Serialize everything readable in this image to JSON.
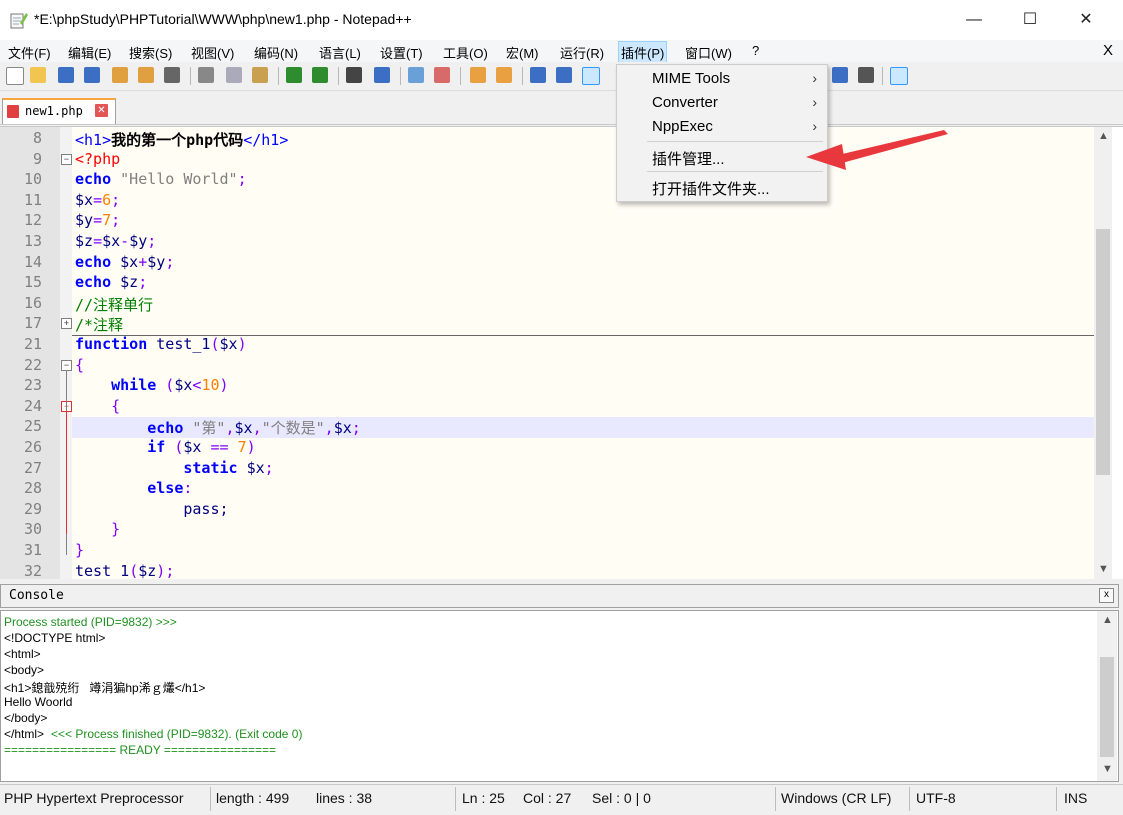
{
  "window": {
    "title": "*E:\\phpStudy\\PHPTutorial\\WWW\\php\\new1.php - Notepad++",
    "minimize": "—",
    "maximize": "☐",
    "close": "✕"
  },
  "menubar": {
    "items": [
      "文件(F)",
      "编辑(E)",
      "搜索(S)",
      "视图(V)",
      "编码(N)",
      "语言(L)",
      "设置(T)",
      "工具(O)",
      "宏(M)",
      "运行(R)",
      "插件(P)",
      "窗口(W)",
      "?"
    ],
    "close": "X"
  },
  "tab": {
    "name": "new1.php",
    "close": "✕"
  },
  "plugins_menu": {
    "items": [
      {
        "label": "MIME Tools",
        "arrow": "›"
      },
      {
        "label": "Converter",
        "arrow": "›"
      },
      {
        "label": "NppExec",
        "arrow": "›"
      },
      {
        "label": "插件管理..."
      },
      {
        "label": "打开插件文件夹..."
      }
    ]
  },
  "editor": {
    "lines": [
      {
        "n": "8"
      },
      {
        "n": "9"
      },
      {
        "n": "10"
      },
      {
        "n": "11"
      },
      {
        "n": "12"
      },
      {
        "n": "13"
      },
      {
        "n": "14"
      },
      {
        "n": "15"
      },
      {
        "n": "16"
      },
      {
        "n": "17"
      },
      {
        "n": "21"
      },
      {
        "n": "22"
      },
      {
        "n": "23"
      },
      {
        "n": "24"
      },
      {
        "n": "25"
      },
      {
        "n": "26"
      },
      {
        "n": "27"
      },
      {
        "n": "28"
      },
      {
        "n": "29"
      },
      {
        "n": "30"
      },
      {
        "n": "31"
      },
      {
        "n": "32"
      }
    ],
    "code": {
      "l8a": "<h1>",
      "l8b": "我的第一个php代码",
      "l8c": "</h1>",
      "l9": "<?php",
      "l10a": "echo",
      "l10b": " \"Hello World\"",
      "l10c": ";",
      "l11a": "$x",
      "l11b": "=",
      "l11c": "6",
      "l11d": ";",
      "l12a": "$y",
      "l12b": "=",
      "l12c": "7",
      "l12d": ";",
      "l13a": "$z",
      "l13b": "=",
      "l13c": "$x",
      "l13d": "-",
      "l13e": "$y",
      "l13f": ";",
      "l14a": "echo",
      "l14b": " $x",
      "l14c": "+",
      "l14d": "$y",
      "l14e": ";",
      "l15a": "echo",
      "l15b": " $z",
      "l15c": ";",
      "l16": "//注释单行",
      "l17": "/*注释",
      "l21a": "function",
      "l21b": " test_1",
      "l21c": "(",
      "l21d": "$x",
      "l21e": ")",
      "l22": "{",
      "l23a": "    while",
      "l23b": " (",
      "l23c": "$x",
      "l23d": "<",
      "l23e": "10",
      "l23f": ")",
      "l24": "    {",
      "l25a": "        echo",
      "l25b": " \"第\"",
      "l25c": ",",
      "l25d": "$x",
      "l25e": ",",
      "l25f": "\"个数是\"",
      "l25g": ",",
      "l25h": "$x",
      "l25i": ";",
      "l26a": "        if",
      "l26b": " (",
      "l26c": "$x",
      "l26d": " == ",
      "l26e": "7",
      "l26f": ")",
      "l27a": "            static",
      "l27b": " $x",
      "l27c": ";",
      "l28a": "        else",
      "l28b": ":",
      "l29": "            pass;",
      "l30": "    }",
      "l31": "}",
      "l32a": "test_1",
      "l32b": "(",
      "l32c": "$z",
      "l32d": ")",
      "l32e": ";"
    }
  },
  "console": {
    "title": "Console",
    "close": "x",
    "lines": [
      "Process started (PID=9832) >>>",
      "<!DOCTYPE html>",
      "<html>",
      "<body>",
      "<h1>鎴戠殑绗   竴涓猵hp浠ｇ爜</h1>",
      "Hello Woorld",
      "</body>",
      "</html>",
      "<<< Process finished (PID=9832). (Exit code 0)",
      "================ READY ================"
    ]
  },
  "statusbar": {
    "language": "PHP Hypertext Preprocessor",
    "length": "length : 499",
    "lines": "lines : 38",
    "ln": "Ln : 25",
    "col": "Col : 27",
    "sel": "Sel : 0 | 0",
    "eol": "Windows (CR LF)",
    "encoding": "UTF-8",
    "mode": "INS"
  },
  "colors": {
    "accent_arrow": "#e8383d",
    "current_line": "#e8e8ff",
    "tab_accent": "#f7a53b"
  }
}
